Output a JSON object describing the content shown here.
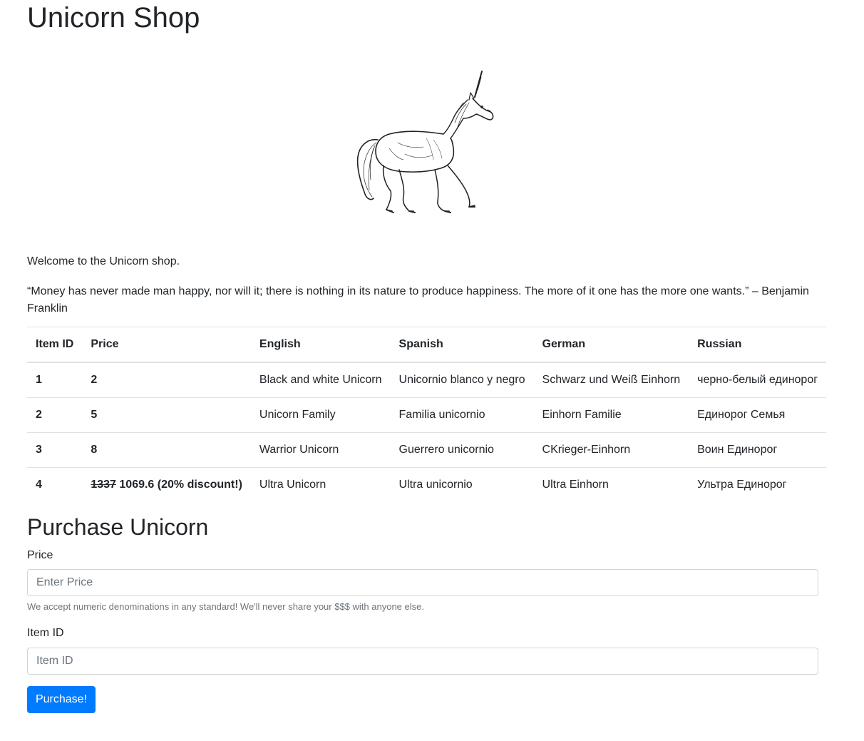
{
  "page": {
    "title": "Unicorn Shop",
    "hero_image": "unicorn-illustration",
    "welcome": "Welcome to the Unicorn shop.",
    "quote": "“Money has never made man happy, nor will it; there is nothing in its nature to produce happiness. The more of it one has the more one wants.” – Benjamin Franklin"
  },
  "table": {
    "headers": [
      "Item ID",
      "Price",
      "English",
      "Spanish",
      "German",
      "Russian"
    ],
    "rows": [
      {
        "id": "1",
        "price": "2",
        "english": "Black and white Unicorn",
        "spanish": "Unicornio blanco y negro",
        "german": "Schwarz und Weiß Einhorn",
        "russian": "черно-белый единорог"
      },
      {
        "id": "2",
        "price": "5",
        "english": "Unicorn Family",
        "spanish": "Familia unicornio",
        "german": "Einhorn Familie",
        "russian": "Единорог Семья"
      },
      {
        "id": "3",
        "price": "8",
        "english": "Warrior Unicorn",
        "spanish": "Guerrero unicornio",
        "german": "CKrieger-Einhorn",
        "russian": "Воин Единорог"
      },
      {
        "id": "4",
        "price_old": "1337",
        "price": "1069.6 (20% discount!)",
        "english": "Ultra Unicorn",
        "spanish": "Ultra unicornio",
        "german": "Ultra Einhorn",
        "russian": "Ультра Единорог"
      }
    ]
  },
  "purchase": {
    "heading": "Purchase Unicorn",
    "price_label": "Price",
    "price_placeholder": "Enter Price",
    "price_help": "We accept numeric denominations in any standard! We'll never share your $$$ with anyone else.",
    "item_label": "Item ID",
    "item_placeholder": "Item ID",
    "button_label": "Purchase!"
  }
}
